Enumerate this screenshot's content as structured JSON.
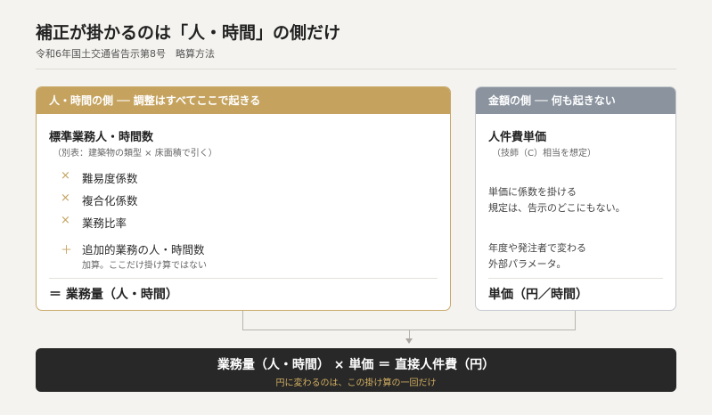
{
  "header": {
    "title": "補正が掛かるのは「人・時間」の側だけ",
    "subtitle": "令和6年国土交通省告示第8号　略算方法"
  },
  "left_panel": {
    "header": "人・時間の側 ── 調整はすべてここで起きる",
    "base_label": "標準業務人・時間数",
    "base_note": "（別表：建築物の類型 × 床面積で引く）",
    "factors": [
      {
        "symbol": "×",
        "label": "難易度係数"
      },
      {
        "symbol": "×",
        "label": "複合化係数"
      },
      {
        "symbol": "×",
        "label": "業務比率"
      }
    ],
    "addition": {
      "symbol": "＋",
      "label": "追加的業務の人・時間数",
      "note": "加算。ここだけ掛け算ではない"
    },
    "result": "＝ 業務量（人・時間）"
  },
  "right_panel": {
    "header": "金額の側 ── 何も起きない",
    "label": "人件費単価",
    "note": "（技師（C）相当を想定）",
    "text1_line1": "単価に係数を掛ける",
    "text1_line2": "規定は、告示のどこにもない。",
    "text2_line1": "年度や発注者で変わる",
    "text2_line2": "外部パラメータ。",
    "result": "単価（円／時間）"
  },
  "bottom": {
    "formula": "業務量（人・時間） × 単価 ＝ 直接人件費（円）",
    "note": "円に変わるのは、この掛け算の一回だけ"
  },
  "colors": {
    "gold": "#c5a35f",
    "slate": "#8a939e",
    "dark": "#282828",
    "background": "#f4f3ef"
  }
}
